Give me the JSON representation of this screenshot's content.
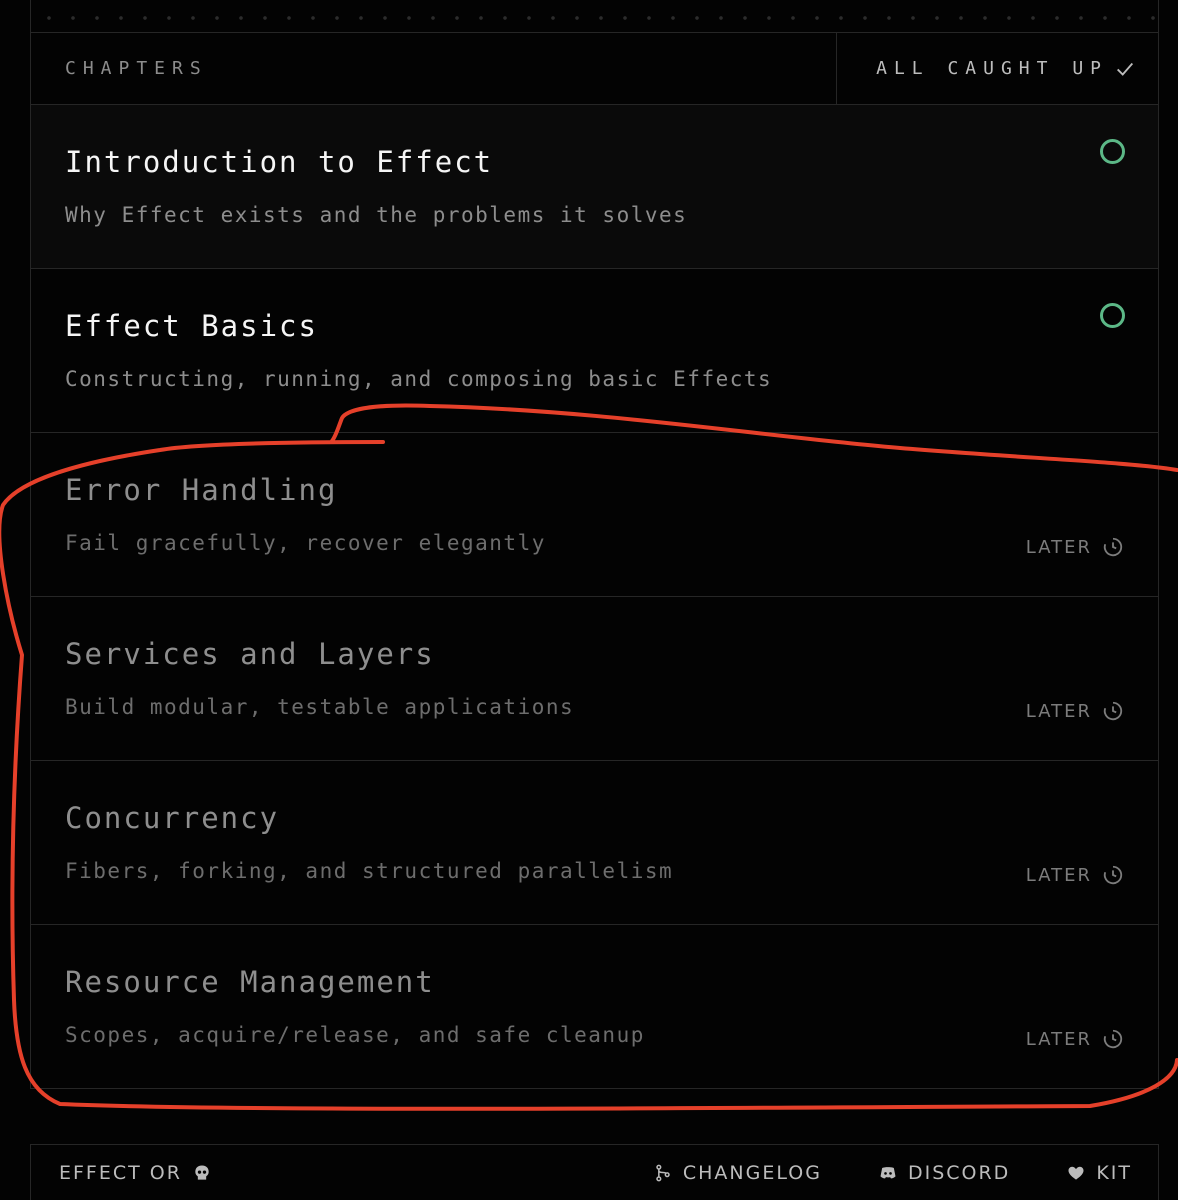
{
  "header": {
    "title": "CHAPTERS",
    "status": "ALL CAUGHT UP"
  },
  "chapters": [
    {
      "title": "Introduction to Effect",
      "description": "Why Effect exists and the problems it solves"
    },
    {
      "title": "Effect Basics",
      "description": "Constructing, running, and composing basic Effects"
    },
    {
      "title": "Error Handling",
      "description": "Fail gracefully, recover elegantly",
      "tag": "LATER"
    },
    {
      "title": "Services and Layers",
      "description": "Build modular, testable applications",
      "tag": "LATER"
    },
    {
      "title": "Concurrency",
      "description": "Fibers, forking, and structured parallelism",
      "tag": "LATER"
    },
    {
      "title": "Resource Management",
      "description": "Scopes, acquire/release, and safe cleanup",
      "tag": "LATER"
    }
  ],
  "footer": {
    "brand": "EFFECT OR",
    "changelog": "CHANGELOG",
    "discord": "DISCORD",
    "kit": "KIT"
  },
  "colors": {
    "background": "#030303",
    "border": "#262626",
    "ring": "#5cb887",
    "annotation": "#e5402a"
  },
  "icons": {
    "status": "check-icon",
    "chapter_progress": "ring-icon",
    "later": "clock-icon",
    "brand": "skull-icon",
    "changelog": "git-branch-icon",
    "discord": "discord-icon",
    "kit": "heart-icon"
  }
}
